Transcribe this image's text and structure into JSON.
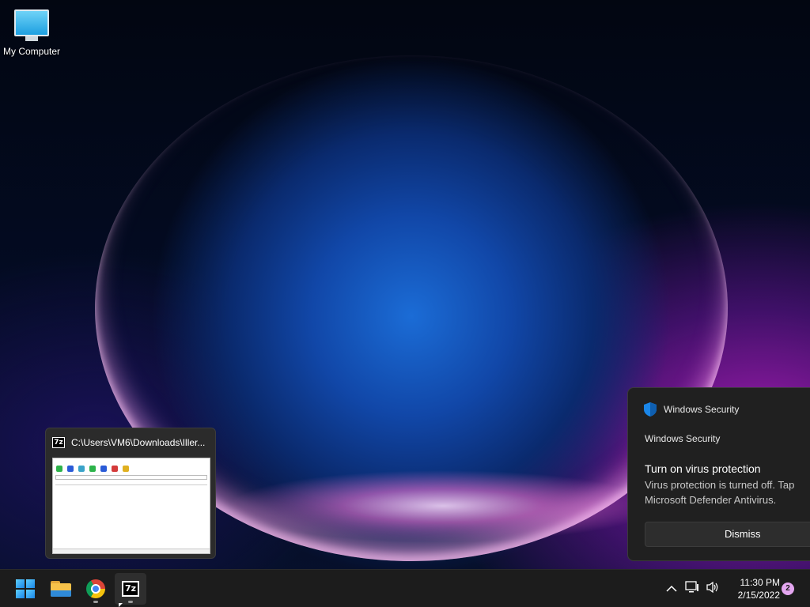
{
  "desktop": {
    "icons": [
      {
        "label": "My Computer",
        "icon": "monitor-icon"
      }
    ]
  },
  "preview": {
    "title": "C:\\Users\\VM6\\Downloads\\Iller...",
    "app_icon_text": "7z"
  },
  "notification": {
    "app_name": "Windows Security",
    "source": "Windows Security",
    "title": "Turn on virus protection",
    "body": "Virus protection is turned off. Tap Microsoft Defender Antivirus.",
    "dismiss_label": "Dismiss",
    "accent": "#1a86e8"
  },
  "taskbar": {
    "apps": [
      {
        "name": "start",
        "icon": "windows-logo-icon"
      },
      {
        "name": "file-explorer",
        "icon": "folder-icon"
      },
      {
        "name": "chrome",
        "icon": "chrome-icon",
        "running": true
      },
      {
        "name": "7-zip",
        "icon": "7z-icon",
        "label": "7z",
        "running": true,
        "active": true
      }
    ],
    "tray": {
      "chevron": "^",
      "network_icon": "network-icon",
      "volume_icon": "volume-icon",
      "time": "11:30 PM",
      "date": "2/15/2022",
      "notification_count": "2"
    }
  }
}
